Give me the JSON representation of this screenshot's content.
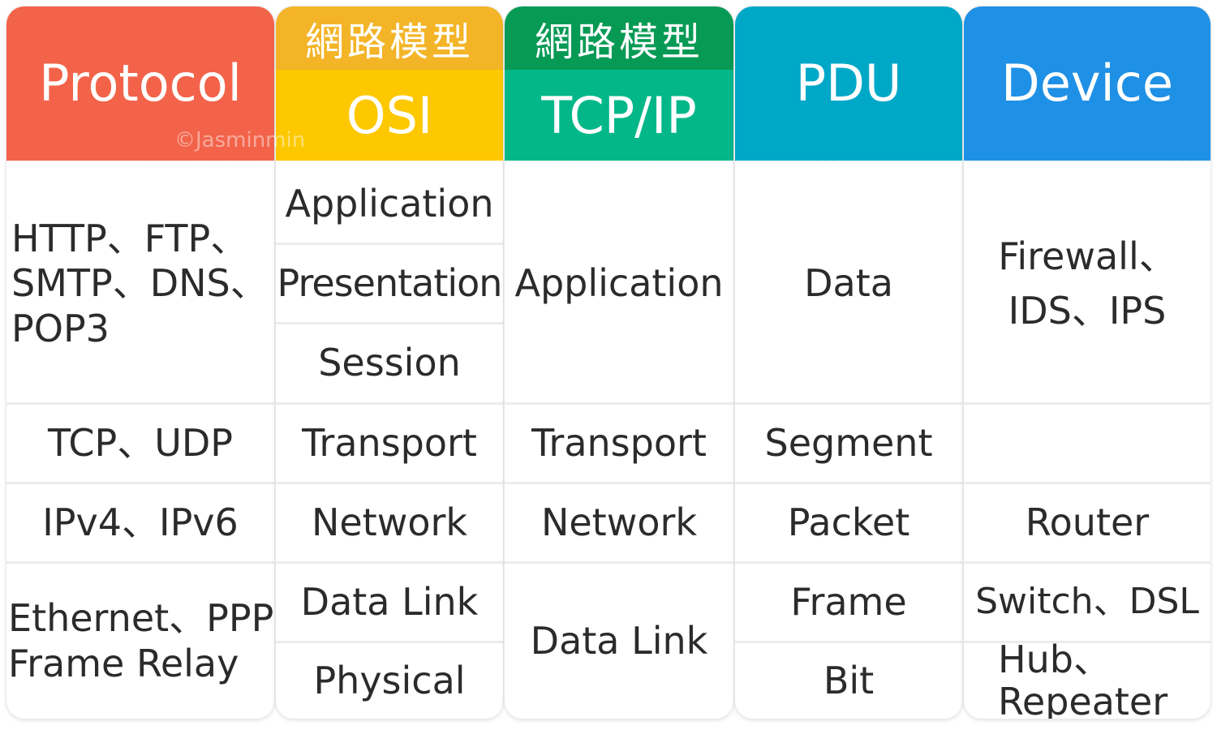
{
  "colors": {
    "protocol": "#f2634a",
    "osi_sub": "#f3b427",
    "osi": "#fdc800",
    "tcpip_sub": "#079a55",
    "tcpip": "#03b789",
    "pdu": "#00a8c8",
    "device": "#1e90e6"
  },
  "watermark": "©Jasminmin",
  "headers": {
    "protocol": "Protocol",
    "osi_sub": "網路模型",
    "osi": "OSI",
    "tcpip_sub": "網路模型",
    "tcpip": "TCP/IP",
    "pdu": "PDU",
    "device": "Device"
  },
  "protocol": {
    "app": "HTTP、FTP、SMTP、DNS、POP3",
    "transport": "TCP、UDP",
    "network": "IPv4、IPv6",
    "link": "Ethernet、PPP Frame Relay"
  },
  "osi": {
    "application": "Application",
    "presentation": "Presentation",
    "session": "Session",
    "transport": "Transport",
    "network": "Network",
    "datalink": "Data Link",
    "physical": "Physical"
  },
  "tcpip": {
    "application": "Application",
    "transport": "Transport",
    "network": "Network",
    "datalink": "Data Link"
  },
  "pdu": {
    "data": "Data",
    "segment": "Segment",
    "packet": "Packet",
    "frame": "Frame",
    "bit": "Bit"
  },
  "device": {
    "app": "Firewall、IDS、IPS",
    "transport": "",
    "network": "Router",
    "datalink": "Switch、DSL",
    "physical": "Hub、Repeater"
  }
}
